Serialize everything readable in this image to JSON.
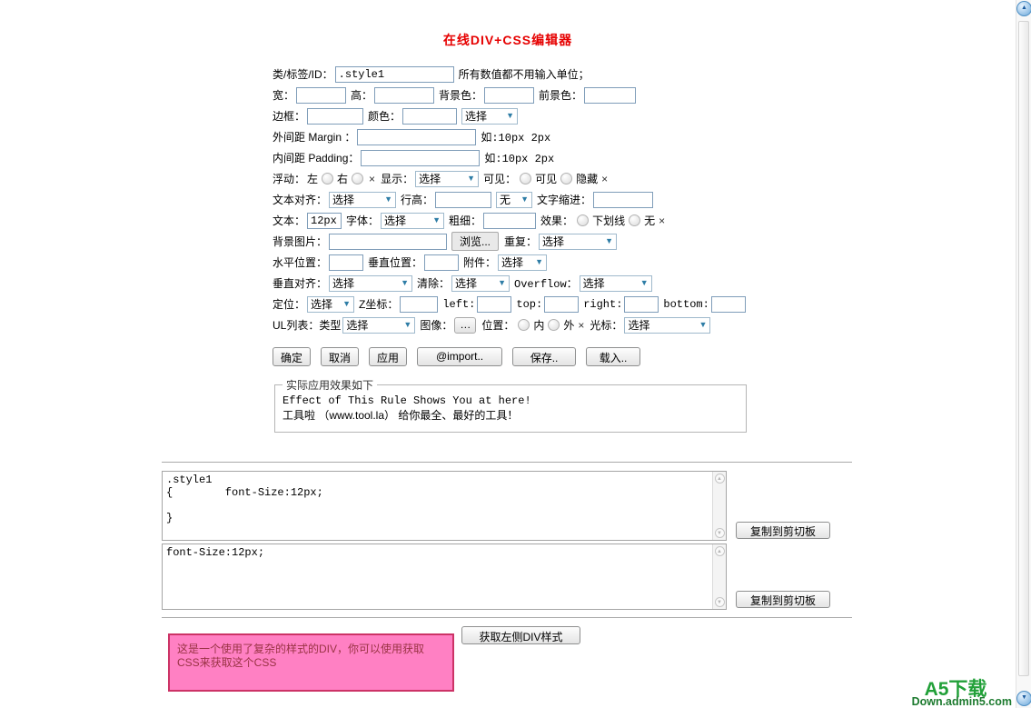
{
  "page": {
    "title": "在线DIV+CSS编辑器"
  },
  "icons": {
    "chevron_down": "▼",
    "arrow_up": "▲",
    "arrow_down": "▼"
  },
  "colors": {
    "title_red": "#e60000",
    "input_border": "#7f9db9",
    "select_arrow_blue": "#2e7da6",
    "pink_bg": "#ff80c3",
    "pink_border": "#cc3366",
    "brand_green": "#21a038"
  },
  "form": {
    "class_label": "类/标签/ID：",
    "class_value": ".style1",
    "units_note": "所有数值都不用输入单位；",
    "width_label": "宽：",
    "height_label": "高：",
    "bg_color_label": "背景色：",
    "fg_color_label": "前景色：",
    "border_label": "边框：",
    "color_label": "颜色：",
    "select_placeholder": "选择",
    "margin_label": "外间距 Margin ：",
    "margin_hint": "如:10px 2px",
    "padding_label": "内间距 Padding：",
    "padding_hint": "如:10px 2px",
    "float_label": "浮动：",
    "float_left": "左",
    "float_right": "右",
    "clear_mark": "×",
    "display_label": "显示：",
    "visibility_label": "可见：",
    "visible_option": "可见",
    "hidden_option": "隐藏",
    "text_align_label": "文本对齐：",
    "line_height_label": "行高：",
    "none_select": "无",
    "text_indent_label": "文字缩进：",
    "text_label": "文本：",
    "text_value": "12px",
    "font_label": "字体：",
    "weight_label": "粗细：",
    "effect_label": "效果：",
    "underline_option": "下划线",
    "none_option": "无",
    "bg_image_label": "背景图片：",
    "browse_button": "浏览...",
    "repeat_label": "重复：",
    "h_pos_label": "水平位置：",
    "v_pos_label": "垂直位置：",
    "attachment_label": "附件：",
    "v_align_label": "垂直对齐：",
    "clear_label": "清除：",
    "overflow_label": "Overflow：",
    "position_label": "定位：",
    "z_index_label": "Z坐标：",
    "left_label": "left:",
    "top_label": "top:",
    "right_label": "right:",
    "bottom_label": "bottom:",
    "ul_list_label": "UL列表：类型",
    "image_label": "图像：",
    "image_button": "…",
    "list_pos_label": "位置：",
    "inside_option": "内",
    "outside_option": "外",
    "cursor_label": "光标："
  },
  "actions": {
    "ok": "确定",
    "cancel": "取消",
    "apply": "应用",
    "import": "@import..",
    "save": "保存..",
    "load": "载入.."
  },
  "preview": {
    "legend": "实际应用效果如下",
    "line1": "Effect of This Rule Shows You at here!",
    "line2": "工具啦 （www.tool.la） 给你最全、最好的工具！"
  },
  "output": {
    "css_full": ".style1\n{        font-Size:12px;\n\n}",
    "css_inline": "font-Size:12px;",
    "copy_label": "复制到剪切板"
  },
  "demo": {
    "fetch_button": "获取左侧DIV样式",
    "pink_text": "这是一个使用了复杂的样式的DIV，你可以使用获取CSS来获取这个CSS"
  },
  "footer": {
    "brand": "A5下载",
    "domain": "Down.admin5.com"
  }
}
